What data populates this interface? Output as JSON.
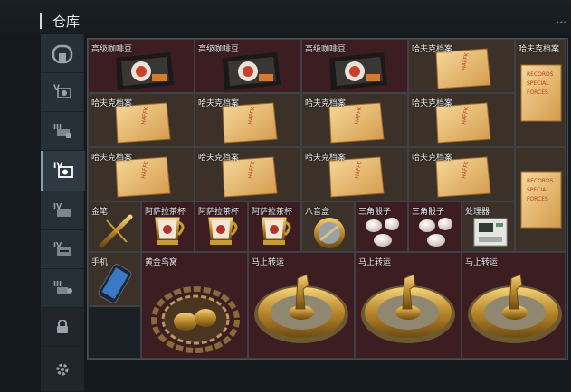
{
  "header": {
    "title": "仓库"
  },
  "sidebar": {
    "tabs": [
      {
        "name": "all"
      },
      {
        "name": "tier-v"
      },
      {
        "name": "tier-iii"
      },
      {
        "name": "tier-iv",
        "active": true
      },
      {
        "name": "tier-iv-b"
      },
      {
        "name": "tier-iv-c"
      },
      {
        "name": "tier-iii-b"
      },
      {
        "name": "locked"
      },
      {
        "name": "settings"
      }
    ]
  },
  "items": {
    "coffee1": "高级咖啡豆",
    "coffee2": "高级咖啡豆",
    "coffee3": "高级咖啡豆",
    "hafu_r1c4": "哈夫克档案",
    "hafu_r1c5": "哈夫克档案",
    "hafu_r2c1": "哈夫克档案",
    "hafu_r2c2": "哈夫克档案",
    "hafu_r2c3": "哈夫克档案",
    "hafu_r2c4": "哈夫克档案",
    "hafu_r3c1": "哈夫克档案",
    "hafu_r3c2": "哈夫克档案",
    "hafu_r3c3": "哈夫克档案",
    "hafu_r3c4": "哈夫克档案",
    "pen": "金笔",
    "cup1": "阿萨拉茶杯",
    "cup2": "阿萨拉茶杯",
    "cup3": "阿萨拉茶杯",
    "compass": "八音盒",
    "dice1": "三角骰子",
    "dice2": "三角骰子",
    "device": "处理器",
    "phone": "手机",
    "nest": "黄金鸟窝",
    "horse1": "马上转运",
    "horse2": "马上转运",
    "horse3": "马上转运"
  }
}
